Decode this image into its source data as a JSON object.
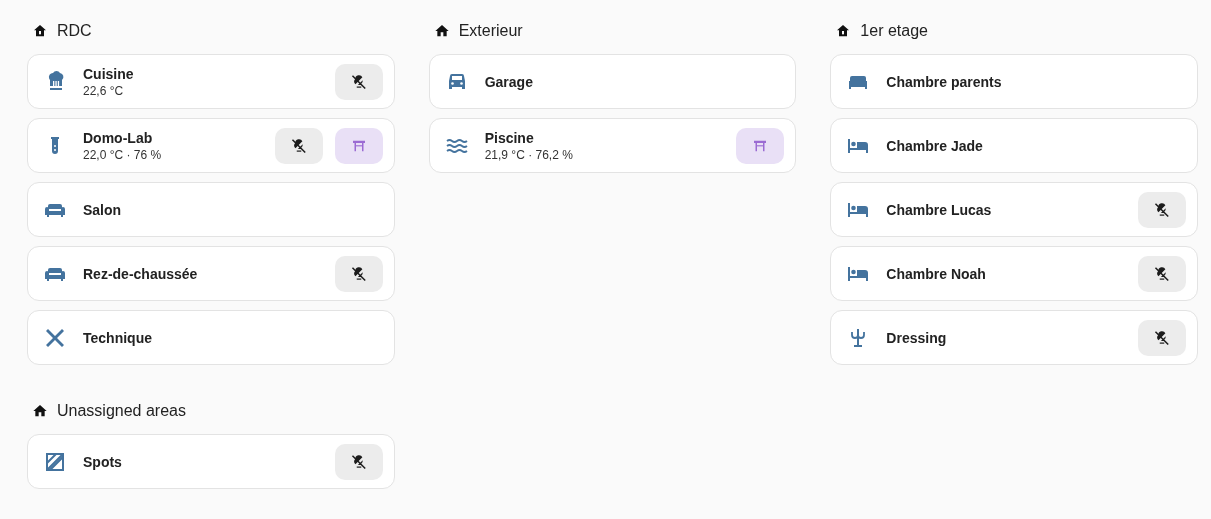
{
  "columns": [
    {
      "sections": [
        {
          "title": "RDC",
          "rooms": [
            {
              "name": "Cuisine",
              "state": "22,6 °C",
              "buttons": [
                {
                  "kind": "light",
                  "on": false
                }
              ]
            },
            {
              "name": "Domo-Lab",
              "state": "22,0 °C · 76 %",
              "buttons": [
                {
                  "kind": "light",
                  "on": false
                },
                {
                  "kind": "table",
                  "on": true
                }
              ]
            },
            {
              "name": "Salon"
            },
            {
              "name": "Rez-de-chaussée",
              "buttons": [
                {
                  "kind": "light",
                  "on": false
                }
              ]
            },
            {
              "name": "Technique"
            }
          ]
        },
        {
          "title": "Unassigned areas",
          "rooms": [
            {
              "name": "Spots",
              "buttons": [
                {
                  "kind": "light",
                  "on": false
                }
              ]
            }
          ]
        }
      ]
    },
    {
      "sections": [
        {
          "title": "Exterieur",
          "rooms": [
            {
              "name": "Garage"
            },
            {
              "name": "Piscine",
              "state": "21,9 °C · 76,2 %",
              "buttons": [
                {
                  "kind": "table",
                  "on": true
                }
              ]
            }
          ]
        }
      ]
    },
    {
      "sections": [
        {
          "title": "1er etage",
          "rooms": [
            {
              "name": "Chambre parents"
            },
            {
              "name": "Chambre Jade"
            },
            {
              "name": "Chambre Lucas",
              "buttons": [
                {
                  "kind": "light",
                  "on": false
                }
              ]
            },
            {
              "name": "Chambre Noah",
              "buttons": [
                {
                  "kind": "light",
                  "on": false
                }
              ]
            },
            {
              "name": "Dressing",
              "buttons": [
                {
                  "kind": "light",
                  "on": false
                }
              ]
            }
          ]
        }
      ]
    }
  ]
}
